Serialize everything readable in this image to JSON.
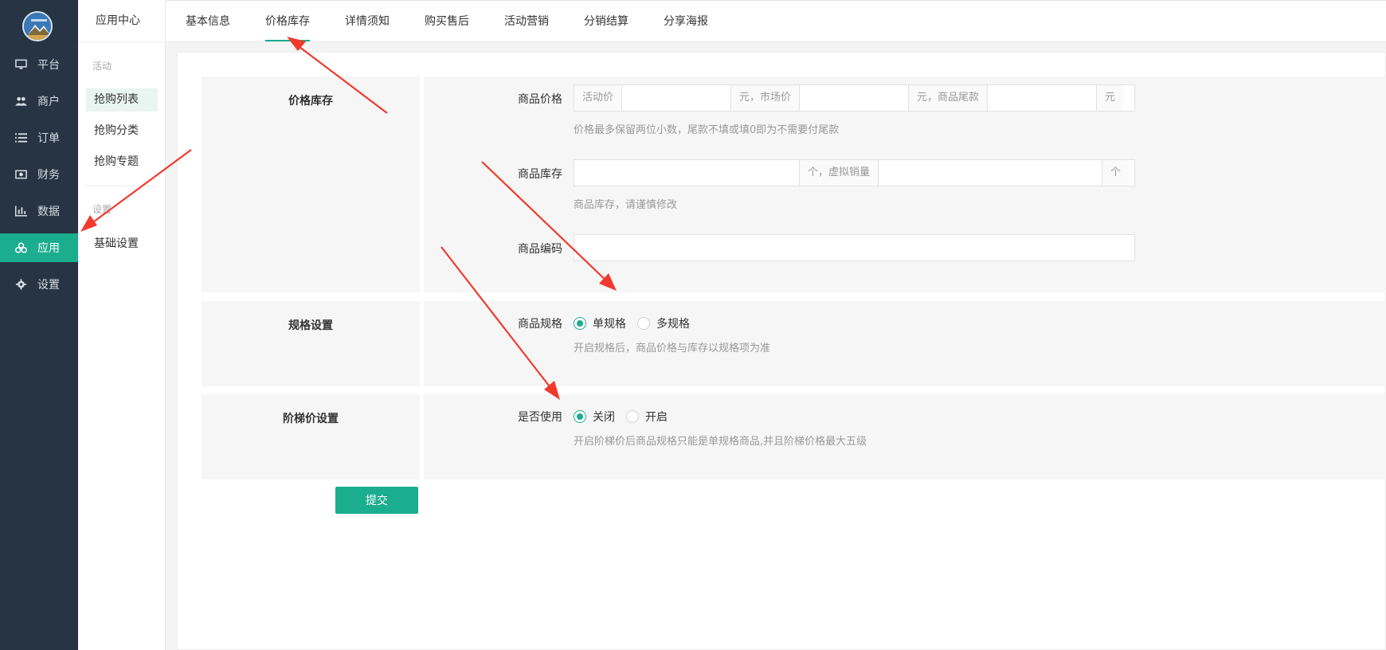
{
  "sidebar": {
    "items": [
      {
        "label": "平台",
        "icon": "monitor-icon"
      },
      {
        "label": "商户",
        "icon": "users-icon"
      },
      {
        "label": "订单",
        "icon": "list-icon"
      },
      {
        "label": "财务",
        "icon": "money-icon"
      },
      {
        "label": "数据",
        "icon": "bar-chart-icon"
      },
      {
        "label": "应用",
        "icon": "apps-icon",
        "active": true
      },
      {
        "label": "设置",
        "icon": "gear-icon"
      }
    ]
  },
  "subnav": {
    "title": "应用中心",
    "group_activity": "活动",
    "items": [
      "抢购列表",
      "抢购分类",
      "抢购专题"
    ],
    "group_settings": "设置",
    "settings_items": [
      "基础设置"
    ]
  },
  "tabs": [
    "基本信息",
    "价格库存",
    "详情须知",
    "购买售后",
    "活动营销",
    "分销结算",
    "分享海报"
  ],
  "active_tab": "价格库存",
  "form": {
    "price_stock": {
      "section_label": "价格库存",
      "price_label": "商品价格",
      "price_addon_1": "活动价",
      "price_addon_2": "元，市场价",
      "price_addon_3": "元，商品尾款",
      "price_addon_4": "元",
      "price_hint": "价格最多保留两位小数，尾款不填或填0即为不需要付尾款",
      "stock_label": "商品库存",
      "stock_addon_1": "个，虚拟销量",
      "stock_addon_2": "个",
      "stock_hint": "商品库存，请谨慎修改",
      "code_label": "商品编码"
    },
    "spec": {
      "section_label": "规格设置",
      "field_label": "商品规格",
      "options": [
        "单规格",
        "多规格"
      ],
      "selected": "单规格",
      "hint": "开启规格后，商品价格与库存以规格项为准"
    },
    "ladder": {
      "section_label": "阶梯价设置",
      "field_label": "是否使用",
      "options": [
        "关闭",
        "开启"
      ],
      "selected": "关闭",
      "hint": "开启阶梯价后商品规格只能是单规格商品,并且阶梯价格最大五级"
    },
    "submit_label": "提交"
  },
  "colors": {
    "accent": "#1aad8e",
    "sidebar_bg": "#263443",
    "annotation_arrow": "#f03a2e"
  }
}
